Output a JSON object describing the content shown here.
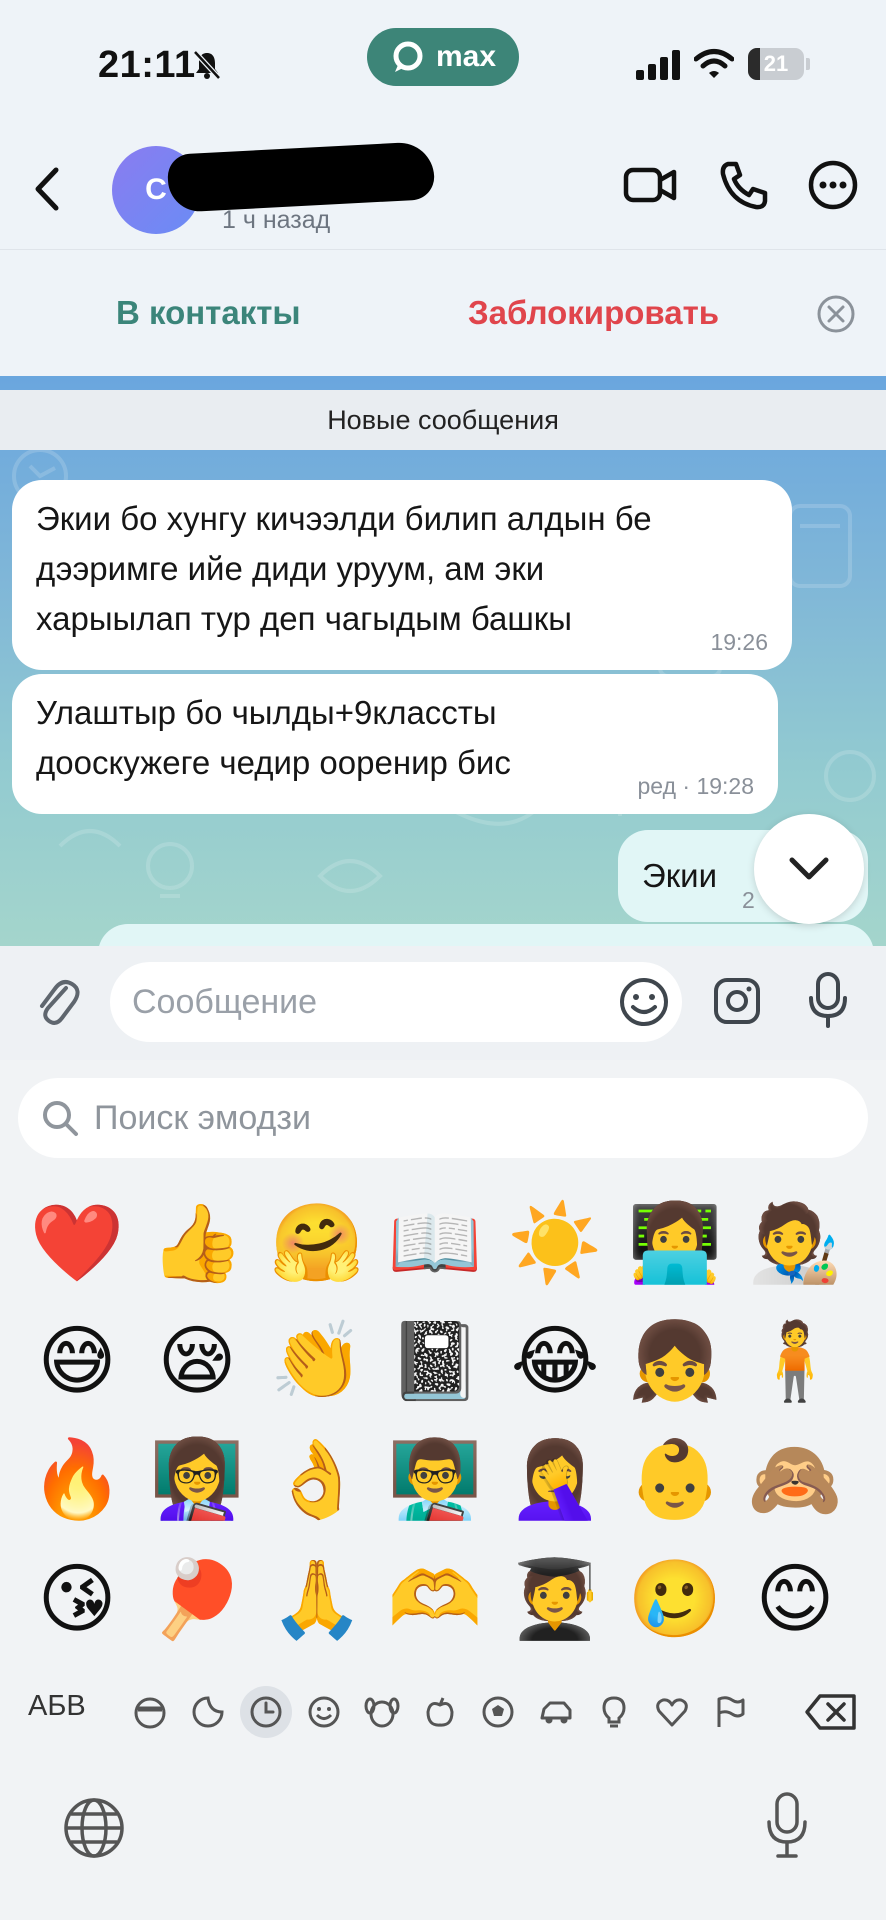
{
  "status_bar": {
    "time": "21:11",
    "app_label": "max",
    "battery": "21",
    "battery_fraction": 0.21
  },
  "chat_header": {
    "avatar_initial": "C",
    "last_seen": "1 ч назад"
  },
  "action_bar": {
    "add_contact": "В контакты",
    "block": "Заблокировать"
  },
  "chat": {
    "divider": "Новые сообщения",
    "messages": [
      {
        "direction": "incoming",
        "lines": [
          "Экии бо хунгу кичээлди билип алдын бе",
          "дээримге ийе диди уруум, ам эки",
          "харыылап тур деп чагыдым башкы"
        ],
        "meta": "19:26"
      },
      {
        "direction": "incoming",
        "lines": [
          "Улаштыр бо чылды+9классты",
          "дооскужеге чедир ооренир бис"
        ],
        "meta": "ред · 19:28"
      },
      {
        "direction": "outgoing",
        "lines": [
          "Экии"
        ],
        "meta": "2"
      }
    ]
  },
  "composer": {
    "placeholder": "Сообщение"
  },
  "emoji_keyboard": {
    "search_placeholder": "Поиск эмодзи",
    "abc_label": "АБВ",
    "rows": [
      [
        "❤️",
        "👍",
        "🤗",
        "📖",
        "☀️",
        "👩‍💻",
        "🧑‍🎨"
      ],
      [
        "😅",
        "😪",
        "👏",
        "📓",
        "😂",
        "👧",
        "🧍"
      ],
      [
        "🔥",
        "👩‍🏫",
        "👌",
        "👨‍🏫",
        "🤦‍♀️",
        "👶",
        "🙈"
      ],
      [
        "😘",
        "🏓",
        "🙏",
        "🫶",
        "🧑‍🎓",
        "🥲",
        "😊"
      ]
    ],
    "categories": [
      "memoji",
      "stickers",
      "recent",
      "smileys",
      "animals",
      "food",
      "activity",
      "travel",
      "objects",
      "symbols",
      "flags"
    ],
    "active_category": "recent"
  },
  "colors": {
    "brand": "#3d8578",
    "danger": "#e0454c",
    "outgoing_bubble": "#e1f6f6"
  }
}
